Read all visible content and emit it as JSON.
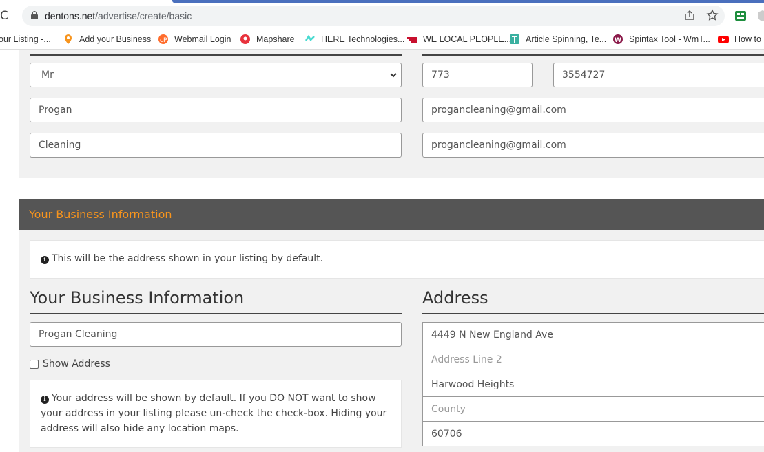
{
  "browser": {
    "url_domain": "dentons.net",
    "url_path": "/advertise/create/basic",
    "bookmarks": [
      {
        "label": "our Listing -...",
        "color": "#ffffff"
      },
      {
        "label": "Add your Business",
        "color": "#f7941d"
      },
      {
        "label": "Webmail Login",
        "color": "#ff6c2c"
      },
      {
        "label": "Mapshare",
        "color": "#e8323c"
      },
      {
        "label": "HERE Technologies...",
        "color": "#48dad0"
      },
      {
        "label": "WE LOCAL PEOPLE...",
        "color": "#c8102e"
      },
      {
        "label": "Article Spinning, Te...",
        "color": "#3ab0a0"
      },
      {
        "label": "Spintax Tool - WmT...",
        "color": "#8b1a4a"
      },
      {
        "label": "How to",
        "color": "#ff0000"
      }
    ]
  },
  "contact": {
    "title_select": "Mr",
    "first_name": "Progan",
    "last_name": "Cleaning",
    "phone_area": "773",
    "phone_number": "3554727",
    "email": "progancleaning@gmail.com",
    "email_confirm": "progancleaning@gmail.com"
  },
  "section_bar_title": "Your Business Information",
  "address_notice": "This will be the address shown in your listing by default.",
  "business": {
    "heading": "Your Business Information",
    "name": "Progan Cleaning",
    "show_address_label": "Show Address",
    "show_address_checked": false,
    "hide_notice": "Your address will be shown by default. If you DO NOT want to show your address in your listing please un-check the check-box. Hiding your address will also hide any location maps."
  },
  "address": {
    "heading": "Address",
    "line1": "4449 N New England Ave",
    "line2_placeholder": "Address Line 2",
    "city": "Harwood Heights",
    "county_placeholder": "County",
    "postcode": "60706"
  }
}
